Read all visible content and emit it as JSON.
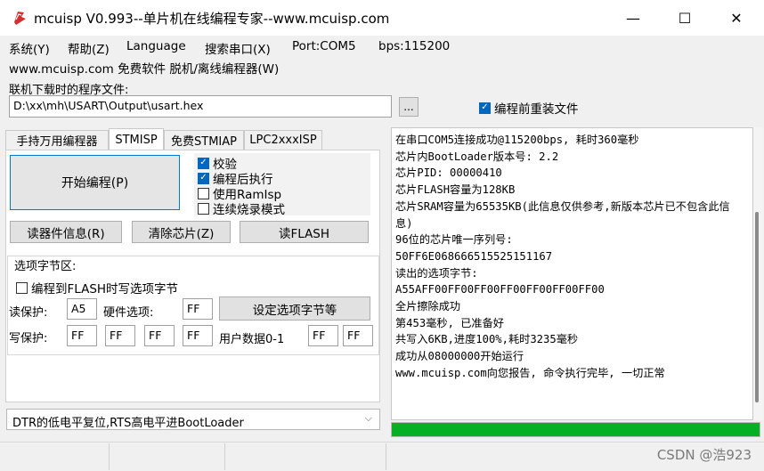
{
  "window": {
    "title": "mcuisp V0.993--单片机在线编程专家--www.mcuisp.com",
    "minimize": "—",
    "maximize": "☐",
    "close": "✕"
  },
  "menu": {
    "items": [
      "系统(Y)",
      "帮助(Z)",
      "Language",
      "搜索串口(X)",
      "Port:COM5",
      "bps:115200"
    ],
    "second_line": "www.mcuisp.com 免费软件 脱机/离线编程器(W)"
  },
  "program_file": {
    "label": "联机下载时的程序文件:",
    "path": "D:\\xx\\mh\\USART\\Output\\usart.hex",
    "browse": "...",
    "reload_label": "编程前重装文件",
    "reload_checked": true
  },
  "tabs": [
    "手持万用编程器",
    "STMISP",
    "免费STMIAP",
    "LPC2xxxISP"
  ],
  "stmisp": {
    "start_button": "开始编程(P)",
    "options": [
      {
        "label": "校验",
        "checked": true
      },
      {
        "label": "编程后执行",
        "checked": true
      },
      {
        "label": "使用RamIsp",
        "checked": false
      },
      {
        "label": "连续烧录模式",
        "checked": false
      }
    ],
    "read_info_button": "读器件信息(R)",
    "erase_button": "清除芯片(Z)",
    "read_flash_button": "读FLASH",
    "option_bytes": {
      "group_title": "选项字节区:",
      "write_when_flash_label": "编程到FLASH时写选项字节",
      "write_when_flash_checked": false,
      "read_protect_label": "读保护:",
      "read_protect_value": "A5",
      "hw_option_label": "硬件选项:",
      "hw_option_value": "FF",
      "set_button": "设定选项字节等",
      "write_protect_label": "写保护:",
      "write_protect_values": [
        "FF",
        "FF",
        "FF",
        "FF"
      ],
      "user_data_label": "用户数据0-1",
      "user_data_values": [
        "FF",
        "FF"
      ]
    }
  },
  "bootloader_mode": "DTR的低电平复位,RTS高电平进BootLoader",
  "log": [
    "在串口COM5连接成功@115200bps, 耗时360毫秒",
    "芯片内BootLoader版本号: 2.2",
    "芯片PID: 00000410",
    "芯片FLASH容量为128KB",
    "芯片SRAM容量为65535KB(此信息仅供参考,新版本芯片已不包含此信息)",
    "96位的芯片唯一序列号:",
    "50FF6E068666515525151167",
    "读出的选项字节:",
    "A55AFF00FF00FF00FF00FF00FF00FF00",
    "全片擦除成功",
    "第453毫秒, 已准备好",
    "共写入6KB,进度100%,耗时3235毫秒",
    "成功从08000000开始运行",
    "www.mcuisp.com向您报告, 命令执行完毕, 一切正常"
  ],
  "progress_percent": 100,
  "watermark": "CSDN @浩923",
  "colors": {
    "progress": "#06b025",
    "checkbox": "#0067c0",
    "icon": "#d32f2f"
  }
}
